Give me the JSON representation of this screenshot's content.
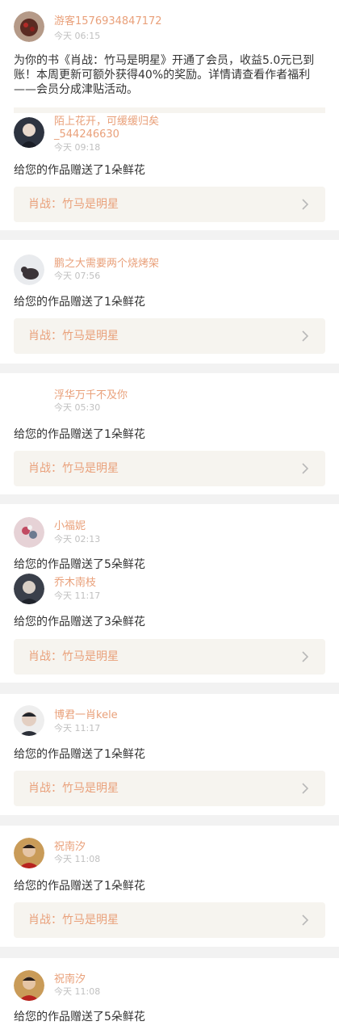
{
  "system_message": {
    "user": "游客1576934847172",
    "time": "今天 06:15",
    "text": "为你的书《肖战：竹马是明星》开通了会员，收益5.0元已到账！本周更新可额外获得40%的奖励。详情请查看作者福利——会员分成津贴活动。"
  },
  "gifts": [
    {
      "user": "陌上花开，可缓缓归矣_544246630",
      "time": "今天 09:18",
      "message": "给您的作品赠送了1朵鲜花",
      "book": "肖战：竹马是明星"
    },
    {
      "user": "鹏之大需要两个烧烤架",
      "time": "今天 07:56",
      "message": "给您的作品赠送了1朵鲜花",
      "book": "肖战：竹马是明星"
    },
    {
      "user": "浮华万千不及你",
      "time": "今天 05:30",
      "message": "给您的作品赠送了1朵鲜花",
      "book": "肖战：竹马是明星"
    },
    {
      "user": "小福妮",
      "time": "今天 02:13",
      "message": "给您的作品赠送了5朵鲜花"
    },
    {
      "user": "乔木南枝",
      "time": "今天 11:17",
      "message": "给您的作品赠送了3朵鲜花",
      "book": "肖战：竹马是明星"
    },
    {
      "user": "博君一肖kele",
      "time": "今天 11:17",
      "message": "给您的作品赠送了1朵鲜花",
      "book": "肖战：竹马是明星"
    },
    {
      "user": "祝南汐",
      "time": "今天 11:08",
      "message": "给您的作品赠送了1朵鲜花",
      "book": "肖战：竹马是明星"
    },
    {
      "user": "祝南汐",
      "time": "今天 11:08",
      "message": "给您的作品赠送了5朵鲜花"
    }
  ],
  "icons": {
    "chevron": "chevron-right-icon"
  },
  "colors": {
    "accent": "#e9a07a",
    "book_bg": "#f6f4ef",
    "separator": "#f2f2f2"
  }
}
